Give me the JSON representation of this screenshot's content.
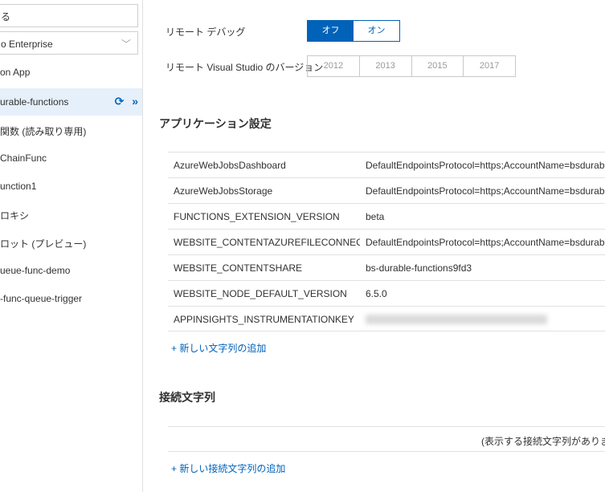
{
  "sidebar": {
    "search_text": "る",
    "subscription": "o Enterprise",
    "items": [
      {
        "label": "on App"
      },
      {
        "label": "urable-functions"
      },
      {
        "label": "関数 (読み取り専用)"
      },
      {
        "label": "ChainFunc"
      },
      {
        "label": "unction1"
      },
      {
        "label": "ロキシ"
      },
      {
        "label": "ロット (プレビュー)"
      },
      {
        "label": "ueue-func-demo"
      },
      {
        "label": "-func-queue-trigger"
      }
    ]
  },
  "main": {
    "remote_debug_label": "リモート デバッグ",
    "toggle_off": "オフ",
    "toggle_on": "オン",
    "vs_version_label": "リモート Visual Studio のバージョン",
    "vs_versions": [
      "2012",
      "2013",
      "2015",
      "2017"
    ],
    "app_settings_title": "アプリケーション設定",
    "app_settings": [
      {
        "key": "AzureWebJobsDashboard",
        "value": "DefaultEndpointsProtocol=https;AccountName=bsdurab"
      },
      {
        "key": "AzureWebJobsStorage",
        "value": "DefaultEndpointsProtocol=https;AccountName=bsdurab"
      },
      {
        "key": "FUNCTIONS_EXTENSION_VERSION",
        "value": "beta"
      },
      {
        "key": "WEBSITE_CONTENTAZUREFILECONNECTI...",
        "value": "DefaultEndpointsProtocol=https;AccountName=bsdurab"
      },
      {
        "key": "WEBSITE_CONTENTSHARE",
        "value": "bs-durable-functions9fd3"
      },
      {
        "key": "WEBSITE_NODE_DEFAULT_VERSION",
        "value": "6.5.0"
      },
      {
        "key": "APPINSIGHTS_INSTRUMENTATIONKEY",
        "value": ""
      }
    ],
    "add_setting": "+ 新しい文字列の追加",
    "conn_strings_title": "接続文字列",
    "conn_empty": "(表示する接続文字列がありませ",
    "add_conn": "+ 新しい接続文字列の追加"
  }
}
